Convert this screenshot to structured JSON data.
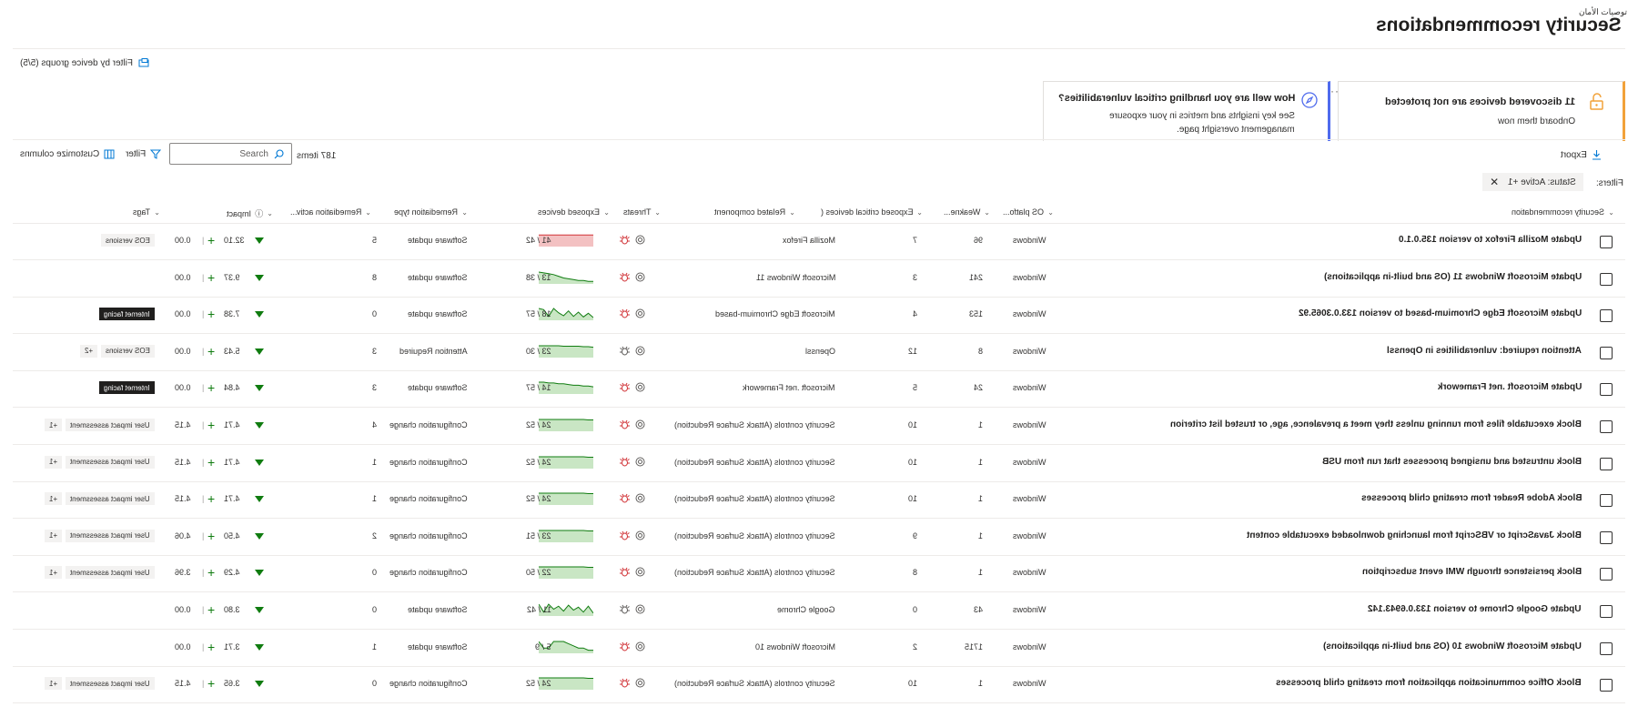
{
  "header": {
    "arabic_title": "توصيات الأمان",
    "title": "Security recommendations",
    "device_group_filter": "Filter by device groups (5/5)"
  },
  "cards": [
    {
      "title": "11 discovered devices are not protected",
      "subtitle": "Onboard them now",
      "icon": "unlock-icon",
      "color": "#f2a23a"
    },
    {
      "title": "How well are you handling critical vulnerabilities?",
      "subtitle_lines": [
        "See key insights and metrics in your exposure",
        "management oversight page."
      ],
      "icon": "compass-icon",
      "color": "#4f6bed"
    }
  ],
  "toolbar": {
    "export": "Export",
    "items_count": "187 items",
    "search_placeholder": "Search",
    "filter": "Filter",
    "customize": "Customize columns",
    "filters_label": "Filters:",
    "status_chip": "Status: Active +1"
  },
  "columns": {
    "name": "Security recommendation",
    "os": "OS platfo...",
    "weak": "Weakne...",
    "critical": "Exposed critical devices (",
    "component": "Related component",
    "threats": "Threats",
    "exposed": "Exposed devices",
    "type": "Remediation type",
    "activity": "Remediation activ...",
    "impact": "Impact",
    "tags": "Tags"
  },
  "rows": [
    {
      "name": "Update Mozilla Firefox to version 135.0.1.0",
      "os": "Windows",
      "weak": "96",
      "critical": "7",
      "component": "Mozilla Firefox",
      "exposed": "41 / 42",
      "spark": [
        41,
        41,
        41,
        41,
        41,
        41,
        41,
        41,
        41,
        41,
        41,
        41
      ],
      "spark_color": "red",
      "type": "Software update",
      "activity": "5",
      "impact_exposure": "32.10",
      "impact_score": "0.00",
      "tags": [
        "EOS versions"
      ],
      "threat_active": true
    },
    {
      "name": "Update Microsoft Windows 11 (OS and built-in applications)",
      "os": "Windows",
      "weak": "241",
      "critical": "3",
      "component": "Microsoft Windows 11",
      "exposed": "13 / 38",
      "spark": [
        2,
        2,
        3,
        3,
        4,
        5,
        6,
        8,
        10,
        11,
        12,
        13
      ],
      "spark_color": "green",
      "type": "Software update",
      "activity": "8",
      "impact_exposure": "9.37",
      "impact_score": "0.00",
      "tags": [],
      "threat_active": true
    },
    {
      "name": "Update Microsoft Edge Chromium-based to version 133.0.3065.92",
      "os": "Windows",
      "weak": "153",
      "critical": "4",
      "component": "Microsoft Edge Chromium-based",
      "exposed": "18 / 57",
      "spark": [
        3,
        10,
        4,
        12,
        5,
        14,
        6,
        11,
        18,
        5,
        16,
        18
      ],
      "spark_color": "green",
      "type": "Software update",
      "activity": "0",
      "impact_exposure": "7.38",
      "impact_score": "0.00",
      "tags": [
        "Internet facing"
      ],
      "tags_dark": true,
      "threat_active": true
    },
    {
      "name": "Attention required: vulnerabilities in Openssl",
      "os": "Windows",
      "weak": "8",
      "critical": "12",
      "component": "Openssl",
      "exposed": "23 / 30",
      "spark": [
        20,
        21,
        21,
        22,
        22,
        22,
        22,
        23,
        23,
        23,
        23,
        23
      ],
      "spark_color": "green",
      "type": "Attention Required",
      "activity": "3",
      "impact_exposure": "5.43",
      "impact_score": "0.00",
      "tags": [
        "EOS versions",
        "+2"
      ],
      "threat_active": false
    },
    {
      "name": "Update Microsoft .net Framework",
      "os": "Windows",
      "weak": "24",
      "critical": "5",
      "component": "Microsoft .net Framework",
      "exposed": "14 / 57",
      "spark": [
        8,
        9,
        9,
        10,
        10,
        11,
        12,
        12,
        13,
        13,
        14,
        14
      ],
      "spark_color": "green",
      "type": "Software update",
      "activity": "3",
      "impact_exposure": "4.84",
      "impact_score": "0.00",
      "tags": [
        "Internet facing"
      ],
      "tags_dark": true,
      "threat_active": true
    },
    {
      "name": "Block executable files from running unless they meet a prevalence, age, or trusted list criterion",
      "os": "Windows",
      "weak": "1",
      "critical": "10",
      "component": "Security controls (Attack Surface Reduction)",
      "exposed": "24 / 52",
      "spark": [
        23,
        23,
        24,
        24,
        24,
        24,
        24,
        24,
        24,
        24,
        24,
        24
      ],
      "spark_color": "green",
      "type": "Configuration change",
      "activity": "4",
      "impact_exposure": "4.71",
      "impact_score": "4.15",
      "tags": [
        "User impact assessment",
        "+1"
      ],
      "threat_active": true
    },
    {
      "name": "Block untrusted and unsigned processes that run from USB",
      "os": "Windows",
      "weak": "1",
      "critical": "10",
      "component": "Security controls (Attack Surface Reduction)",
      "exposed": "24 / 52",
      "spark": [
        23,
        23,
        24,
        24,
        24,
        24,
        24,
        24,
        24,
        24,
        24,
        24
      ],
      "spark_color": "green",
      "type": "Configuration change",
      "activity": "1",
      "impact_exposure": "4.71",
      "impact_score": "4.15",
      "tags": [
        "User impact assessment",
        "+1"
      ],
      "threat_active": true
    },
    {
      "name": "Block Adobe Reader from creating child processes",
      "os": "Windows",
      "weak": "1",
      "critical": "10",
      "component": "Security controls (Attack Surface Reduction)",
      "exposed": "24 / 52",
      "spark": [
        23,
        23,
        24,
        24,
        24,
        24,
        24,
        24,
        24,
        24,
        24,
        24
      ],
      "spark_color": "green",
      "type": "Configuration change",
      "activity": "1",
      "impact_exposure": "4.71",
      "impact_score": "4.15",
      "tags": [
        "User impact assessment",
        "+1"
      ],
      "threat_active": true
    },
    {
      "name": "Block JavaScript or VBScript from launching downloaded executable content",
      "os": "Windows",
      "weak": "1",
      "critical": "9",
      "component": "Security controls (Attack Surface Reduction)",
      "exposed": "23 / 51",
      "spark": [
        22,
        22,
        23,
        23,
        23,
        23,
        23,
        23,
        23,
        23,
        23,
        23
      ],
      "spark_color": "green",
      "type": "Configuration change",
      "activity": "2",
      "impact_exposure": "4.50",
      "impact_score": "4.06",
      "tags": [
        "User impact assessment",
        "+1"
      ],
      "threat_active": true
    },
    {
      "name": "Block persistence through WMI event subscription",
      "os": "Windows",
      "weak": "1",
      "critical": "8",
      "component": "Security controls (Attack Surface Reduction)",
      "exposed": "22 / 50",
      "spark": [
        21,
        21,
        22,
        22,
        22,
        22,
        22,
        22,
        22,
        22,
        22,
        22
      ],
      "spark_color": "green",
      "type": "Configuration change",
      "activity": "0",
      "impact_exposure": "4.29",
      "impact_score": "3.96",
      "tags": [
        "User impact assessment",
        "+1"
      ],
      "threat_active": true
    },
    {
      "name": "Update Google Chrome to version 133.0.6943.142",
      "os": "Windows",
      "weak": "43",
      "critical": "0",
      "component": "Google Chrome",
      "exposed": "11 / 42",
      "spark": [
        2,
        9,
        3,
        8,
        5,
        10,
        4,
        9,
        6,
        11,
        3,
        11
      ],
      "spark_color": "green",
      "type": "Software update",
      "activity": "0",
      "impact_exposure": "3.80",
      "impact_score": "0.00",
      "tags": [],
      "threat_active": false
    },
    {
      "name": "Update Microsoft Windows 10 (OS and built-in applications)",
      "os": "Windows",
      "weak": "1715",
      "critical": "2",
      "component": "Microsoft Windows 10",
      "exposed": "5 / 9",
      "spark": [
        1,
        1,
        2,
        2,
        3,
        4,
        5,
        5,
        5,
        2,
        2,
        5
      ],
      "spark_color": "green",
      "type": "Software update",
      "activity": "1",
      "impact_exposure": "3.71",
      "impact_score": "0.00",
      "tags": [],
      "threat_active": true
    },
    {
      "name": "Block Office communication application from creating child processes",
      "os": "Windows",
      "weak": "1",
      "critical": "10",
      "component": "Security controls (Attack Surface Reduction)",
      "exposed": "24 / 52",
      "spark": [
        23,
        23,
        24,
        24,
        24,
        24,
        24,
        24,
        24,
        24,
        24,
        24
      ],
      "spark_color": "green",
      "type": "Configuration change",
      "activity": "0",
      "impact_exposure": "3.65",
      "impact_score": "4.15",
      "tags": [
        "User impact assessment",
        "+1"
      ],
      "threat_active": true
    }
  ]
}
